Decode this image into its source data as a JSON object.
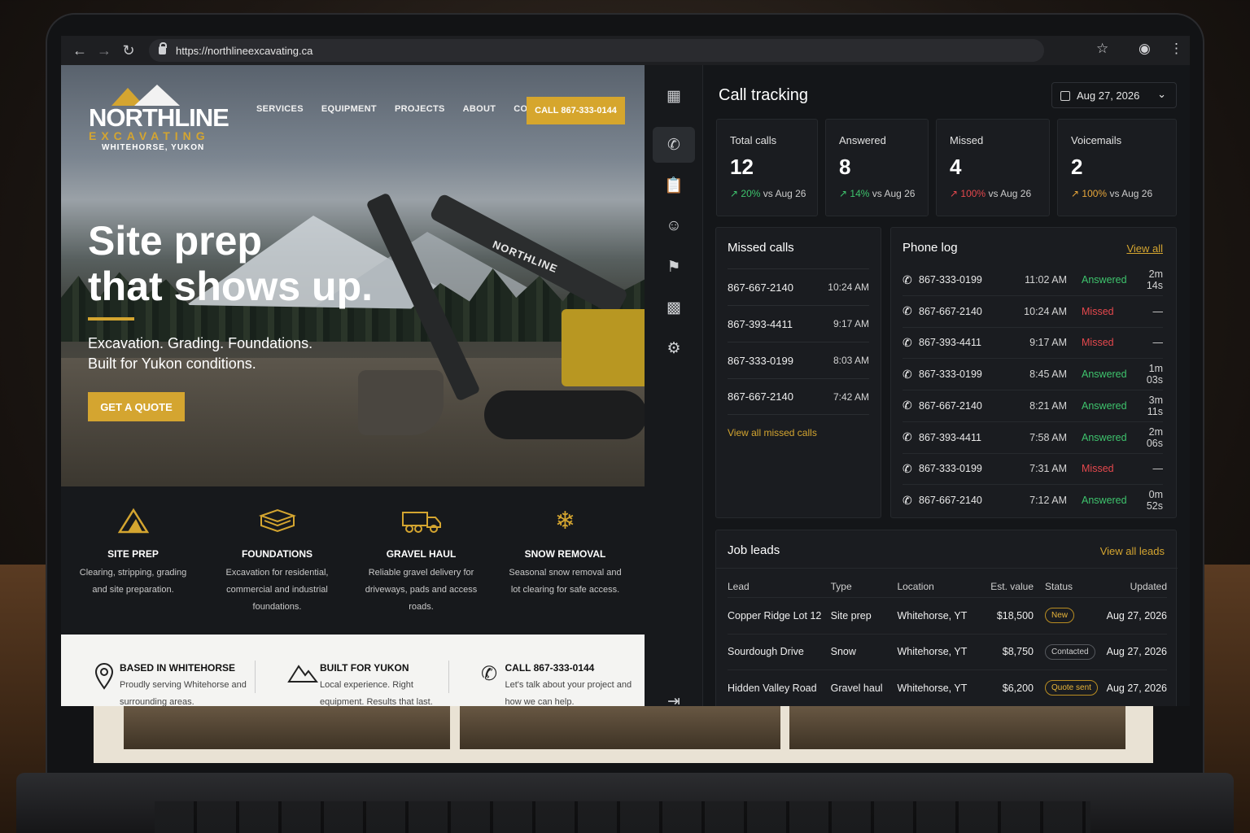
{
  "browser": {
    "url": "https://northlineexcavating.ca"
  },
  "site": {
    "logo": {
      "name": "NORTHLINE",
      "sub": "EXCAVATING",
      "location": "WHITEHORSE, YUKON"
    },
    "nav": [
      "SERVICES",
      "EQUIPMENT",
      "PROJECTS",
      "ABOUT",
      "CONTACT"
    ],
    "call_button": "CALL 867-333-0144",
    "machine_brand": "NORTHLINE",
    "hero": {
      "title_line1": "Site prep",
      "title_line2": "that shows up.",
      "sub_line1": "Excavation. Grading. Foundations.",
      "sub_line2": "Built for Yukon conditions.",
      "cta": "GET A QUOTE"
    },
    "services": [
      {
        "icon": "mountain-icon",
        "title": "SITE PREP",
        "desc": "Clearing, stripping, grading and site preparation."
      },
      {
        "icon": "foundation-icon",
        "title": "FOUNDATIONS",
        "desc": "Excavation for residential, commercial and industrial foundations."
      },
      {
        "icon": "dump-truck-icon",
        "title": "GRAVEL HAUL",
        "desc": "Reliable gravel delivery for driveways, pads and access roads."
      },
      {
        "icon": "snowflake-icon",
        "title": "SNOW REMOVAL",
        "desc": "Seasonal snow removal and lot clearing for safe access."
      }
    ],
    "info": [
      {
        "icon": "location-pin-icon",
        "title": "BASED IN WHITEHORSE",
        "desc": "Proudly serving Whitehorse and surrounding areas."
      },
      {
        "icon": "mountain-outline-icon",
        "title": "BUILT FOR YUKON",
        "desc": "Local experience. Right equipment. Results that last."
      },
      {
        "icon": "phone-icon",
        "title": "CALL 867-333-0144",
        "desc": "Let's talk about your project and how we can help."
      }
    ]
  },
  "dashboard": {
    "title": "Call tracking",
    "date": "Aug 27, 2026",
    "stats": [
      {
        "label": "Total calls",
        "value": "12",
        "change": "20%",
        "compare": "vs Aug 26",
        "trend": "up"
      },
      {
        "label": "Answered",
        "value": "8",
        "change": "14%",
        "compare": "vs Aug 26",
        "trend": "up"
      },
      {
        "label": "Missed",
        "value": "4",
        "change": "100%",
        "compare": "vs Aug 26",
        "trend": "bad"
      },
      {
        "label": "Voicemails",
        "value": "2",
        "change": "100%",
        "compare": "vs Aug 26",
        "trend": "warn"
      }
    ],
    "missed": {
      "title": "Missed calls",
      "rows": [
        {
          "number": "867-667-2140",
          "time": "10:24 AM"
        },
        {
          "number": "867-393-4411",
          "time": "9:17 AM"
        },
        {
          "number": "867-333-0199",
          "time": "8:03 AM"
        },
        {
          "number": "867-667-2140",
          "time": "7:42 AM"
        }
      ],
      "link": "View all missed calls"
    },
    "phone_log": {
      "title": "Phone log",
      "link": "View all",
      "rows": [
        {
          "number": "867-333-0199",
          "time": "11:02 AM",
          "status": "Answered",
          "duration": "2m 14s"
        },
        {
          "number": "867-667-2140",
          "time": "10:24 AM",
          "status": "Missed",
          "duration": "—"
        },
        {
          "number": "867-393-4411",
          "time": "9:17 AM",
          "status": "Missed",
          "duration": "—"
        },
        {
          "number": "867-333-0199",
          "time": "8:45 AM",
          "status": "Answered",
          "duration": "1m 03s"
        },
        {
          "number": "867-667-2140",
          "time": "8:21 AM",
          "status": "Answered",
          "duration": "3m 11s"
        },
        {
          "number": "867-393-4411",
          "time": "7:58 AM",
          "status": "Answered",
          "duration": "2m 06s"
        },
        {
          "number": "867-333-0199",
          "time": "7:31 AM",
          "status": "Missed",
          "duration": "—"
        },
        {
          "number": "867-667-2140",
          "time": "7:12 AM",
          "status": "Answered",
          "duration": "0m 52s"
        }
      ]
    },
    "leads": {
      "title": "Job leads",
      "link": "View all leads",
      "columns": [
        "Lead",
        "Type",
        "Location",
        "Est. value",
        "Status",
        "Updated"
      ],
      "rows": [
        {
          "lead": "Copper Ridge Lot 12",
          "type": "Site prep",
          "location": "Whitehorse, YT",
          "value": "$18,500",
          "status": "New",
          "updated": "Aug 27, 2026"
        },
        {
          "lead": "Sourdough Drive",
          "type": "Snow",
          "location": "Whitehorse, YT",
          "value": "$8,750",
          "status": "Contacted",
          "updated": "Aug 27, 2026"
        },
        {
          "lead": "Hidden Valley Road",
          "type": "Gravel haul",
          "location": "Whitehorse, YT",
          "value": "$6,200",
          "status": "Quote sent",
          "updated": "Aug 27, 2026"
        }
      ]
    }
  }
}
